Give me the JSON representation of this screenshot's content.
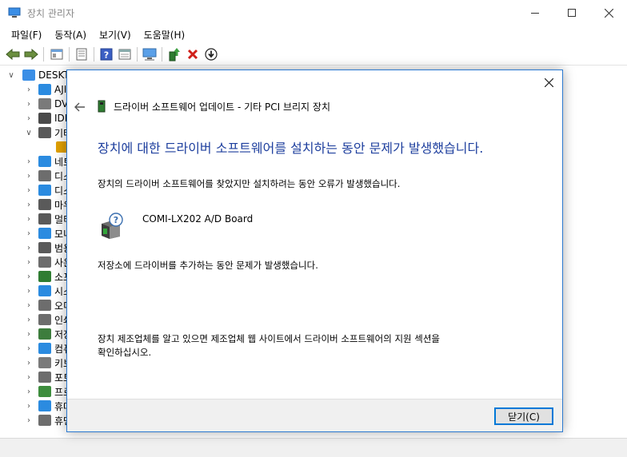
{
  "window": {
    "title": "장치 관리자",
    "app_icon": "device-manager-icon"
  },
  "menu": [
    {
      "label": "파일(F)"
    },
    {
      "label": "동작(A)"
    },
    {
      "label": "보기(V)"
    },
    {
      "label": "도움말(H)"
    }
  ],
  "toolbar": {
    "buttons": [
      "back-arrow-icon",
      "forward-arrow-icon",
      "properties-icon",
      "show-hidden-icon",
      "help-icon",
      "view-icon",
      "monitor-scan-icon",
      "update-driver-icon",
      "uninstall-x-icon",
      "download-icon"
    ]
  },
  "tree": {
    "root_label": "DESKT",
    "items": [
      {
        "label": "AJI",
        "expanded": false,
        "icon": "network-adapter-icon",
        "color": "#2b8be0"
      },
      {
        "label": "DV",
        "expanded": false,
        "icon": "dvd-drive-icon",
        "color": "#7a7a7a"
      },
      {
        "label": "IDE",
        "expanded": false,
        "icon": "ide-controller-icon",
        "color": "#4a4a4a"
      },
      {
        "label": "기터",
        "expanded": true,
        "icon": "unknown-device-icon",
        "color": "#5a5a5a"
      },
      {
        "label": "",
        "expanded": false,
        "icon": "warning-device-icon",
        "color": "#e0a000",
        "child": true
      },
      {
        "label": "네트",
        "expanded": false,
        "icon": "network-icon",
        "color": "#2b8be0"
      },
      {
        "label": "디스",
        "expanded": false,
        "icon": "disk-drive-icon",
        "color": "#6d6d6d"
      },
      {
        "label": "디스",
        "expanded": false,
        "icon": "display-adapter-icon",
        "color": "#2b8be0"
      },
      {
        "label": "마우",
        "expanded": false,
        "icon": "mouse-icon",
        "color": "#5a5a5a"
      },
      {
        "label": "멀티",
        "expanded": false,
        "icon": "multi-port-icon",
        "color": "#5a5a5a"
      },
      {
        "label": "모니",
        "expanded": false,
        "icon": "monitor-icon",
        "color": "#2b8be0"
      },
      {
        "label": "범용",
        "expanded": false,
        "icon": "usb-icon",
        "color": "#5a5a5a"
      },
      {
        "label": "사운",
        "expanded": false,
        "icon": "sound-icon",
        "color": "#6d6d6d"
      },
      {
        "label": "소프",
        "expanded": false,
        "icon": "software-device-icon",
        "color": "#2f7d32"
      },
      {
        "label": "시스",
        "expanded": false,
        "icon": "system-device-icon",
        "color": "#2b8be0"
      },
      {
        "label": "오디",
        "expanded": false,
        "icon": "audio-icon",
        "color": "#6d6d6d"
      },
      {
        "label": "인쇄",
        "expanded": false,
        "icon": "print-queue-icon",
        "color": "#6d6d6d"
      },
      {
        "label": "저장",
        "expanded": false,
        "icon": "storage-controller-icon",
        "color": "#3d7d3d"
      },
      {
        "label": "컴퓨",
        "expanded": false,
        "icon": "computer-icon",
        "color": "#2b8be0"
      },
      {
        "label": "키보",
        "expanded": false,
        "icon": "keyboard-icon",
        "color": "#7a7a7a"
      },
      {
        "label": "포트",
        "expanded": false,
        "icon": "port-icon",
        "color": "#6d6d6d"
      },
      {
        "label": "프로",
        "expanded": false,
        "icon": "processor-icon",
        "color": "#3d8d3d"
      },
      {
        "label": "휴대",
        "expanded": false,
        "icon": "portable-device-icon",
        "color": "#2b8be0"
      },
      {
        "label": "휴먼",
        "expanded": false,
        "icon": "hid-icon",
        "color": "#6d6d6d"
      }
    ]
  },
  "dialog": {
    "header_title": "드라이버 소프트웨어 업데이트 - 기타 PCI 브리지 장치",
    "main_instruction": "장치에 대한 드라이버 소프트웨어를 설치하는 동안 문제가 발생했습니다.",
    "paragraph1": "장치의 드라이버 소프트웨어를 찾았지만 설치하려는 동안 오류가 발생했습니다.",
    "device_name": "COMI-LX202 A/D Board",
    "paragraph2": "저장소에 드라이버를 추가하는 동안 문제가 발생했습니다.",
    "paragraph3_line1": "장치 제조업체를 알고 있으면 제조업체 웹 사이트에서 드라이버 소프트웨어의 지원 섹션을",
    "paragraph3_line2": "확인하십시오.",
    "close_label": "닫기(C)",
    "accent_color": "#1e3f9e"
  }
}
